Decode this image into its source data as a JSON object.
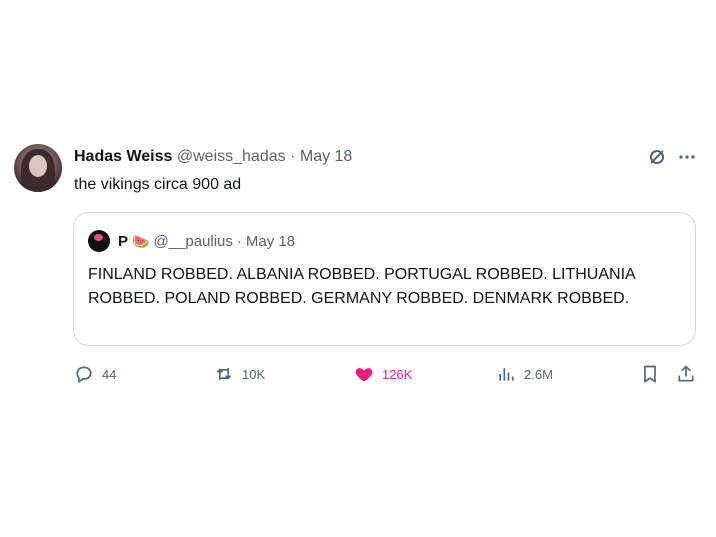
{
  "tweet": {
    "author_name": "Hadas Weiss",
    "author_handle": "@weiss_hadas",
    "separator": "·",
    "date": "May 18",
    "text": "the vikings circa 900 ad"
  },
  "quote": {
    "author_name": "P",
    "emoji": "🍉",
    "author_handle": "@__paulius",
    "separator": "·",
    "date": "May 18",
    "text": "FINLAND ROBBED. ALBANIA ROBBED. PORTUGAL ROBBED. LITHUANIA ROBBED. POLAND ROBBED. GERMANY ROBBED. DENMARK ROBBED."
  },
  "actions": {
    "replies": "44",
    "retweets": "10K",
    "likes": "126K",
    "views": "2.6M"
  },
  "colors": {
    "like_active": "#f91880",
    "muted": "#536471",
    "border": "#cfd9de"
  },
  "icons": {
    "grok": "grok-icon",
    "more": "more-icon",
    "reply": "reply-icon",
    "retweet": "retweet-icon",
    "like": "heart-icon",
    "views": "views-icon",
    "bookmark": "bookmark-icon",
    "share": "share-icon"
  }
}
